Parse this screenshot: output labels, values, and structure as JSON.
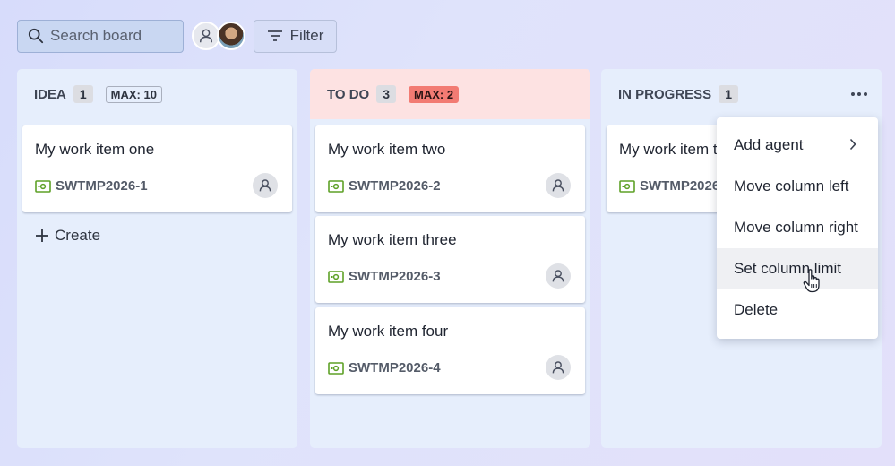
{
  "toolbar": {
    "search_placeholder": "Search board",
    "filter_label": "Filter",
    "avatars": [
      "user-icon",
      "user-photo"
    ]
  },
  "columns": [
    {
      "name": "IDEA",
      "count": "1",
      "limit": "MAX: 10",
      "cards": [
        {
          "title": "My work item one",
          "key": "SWTMP2026-1"
        }
      ],
      "create_label": "Create"
    },
    {
      "name": "TO DO",
      "count": "3",
      "limit": "MAX: 2",
      "limit_color": "#f27b73",
      "header_color": "#fde2e2",
      "cards": [
        {
          "title": "My work item two",
          "key": "SWTMP2026-2"
        },
        {
          "title": "My work item three",
          "key": "SWTMP2026-3"
        },
        {
          "title": "My work item four",
          "key": "SWTMP2026-4"
        }
      ]
    },
    {
      "name": "IN PROGRESS",
      "count": "1",
      "cards": [
        {
          "title": "My work item t",
          "key": "SWTMP2026"
        }
      ]
    }
  ],
  "menu": {
    "items": [
      "Add agent",
      "Move column left",
      "Move column right",
      "Set column limit",
      "Delete"
    ],
    "hovered": "Set column limit"
  },
  "colors": {
    "key_icon": "#5ea127",
    "column_bg": "#e6eefc"
  }
}
